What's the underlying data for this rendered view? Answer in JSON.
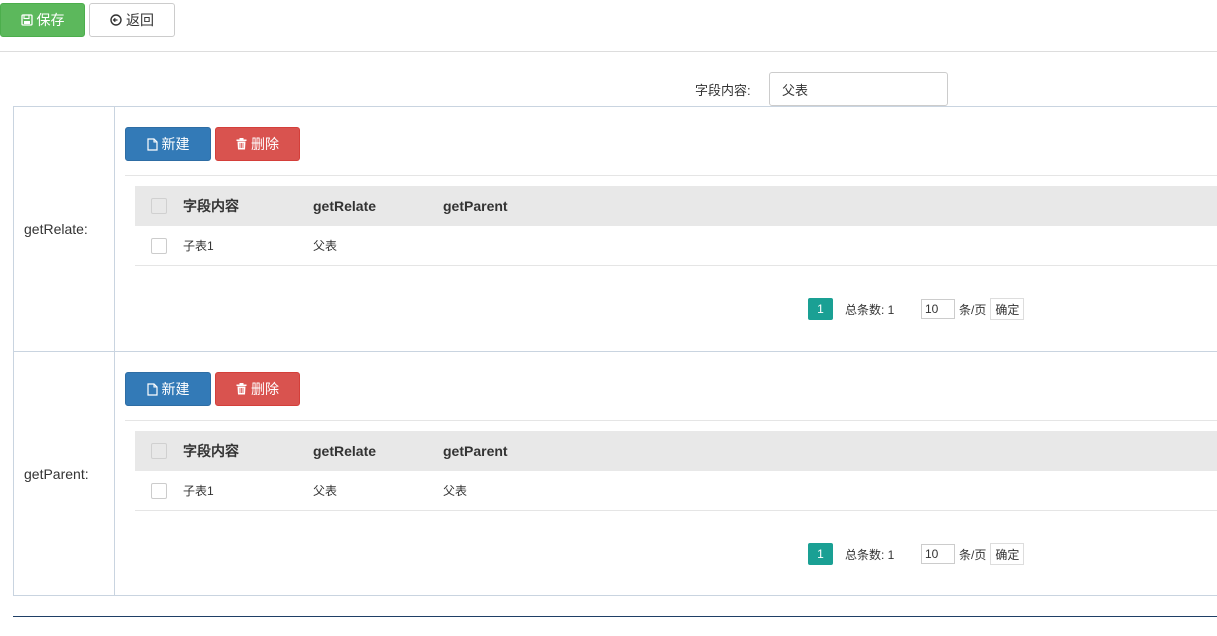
{
  "toolbar": {
    "save_label": "保存",
    "back_label": "返回"
  },
  "field": {
    "label": "字段内容:",
    "value": "父表"
  },
  "sections": [
    {
      "label": "getRelate:",
      "new_label": "新建",
      "delete_label": "删除",
      "columns": [
        "字段内容",
        "getRelate",
        "getParent"
      ],
      "rows": [
        [
          "子表1",
          "父表",
          ""
        ]
      ],
      "pager": {
        "page": "1",
        "total": "总条数: 1",
        "size": "10",
        "unit": "条/页",
        "confirm": "确定"
      }
    },
    {
      "label": "getParent:",
      "new_label": "新建",
      "delete_label": "删除",
      "columns": [
        "字段内容",
        "getRelate",
        "getParent"
      ],
      "rows": [
        [
          "子表1",
          "父表",
          "父表"
        ]
      ],
      "pager": {
        "page": "1",
        "total": "总条数: 1",
        "size": "10",
        "unit": "条/页",
        "confirm": "确定"
      }
    }
  ],
  "colors": {
    "save": "#5cb85c",
    "new": "#337ab7",
    "delete": "#d9534f",
    "page_active": "#1aa094"
  }
}
